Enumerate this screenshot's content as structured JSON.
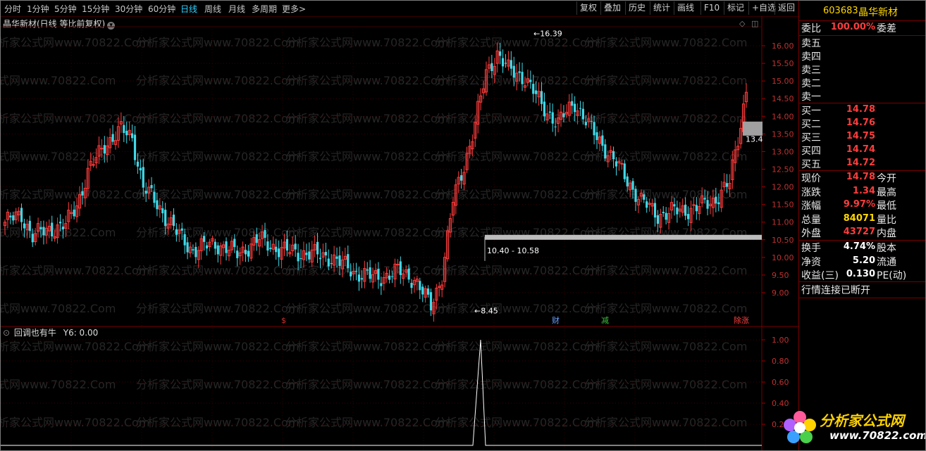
{
  "toolbar": {
    "periods": [
      "分时",
      "1分钟",
      "5分钟",
      "15分钟",
      "30分钟",
      "60分钟",
      "日线",
      "周线",
      "月线",
      "多周期",
      "更多>"
    ],
    "active_period": "日线",
    "buttons": [
      "复权",
      "叠加",
      "历史",
      "统计",
      "画线",
      "F10",
      "标记",
      "+自选",
      "返回"
    ]
  },
  "chart": {
    "title": "晶华新材(日线 等比前复权)",
    "y_ticks": [
      "16.00",
      "15.50",
      "15.00",
      "14.50",
      "14.00",
      "13.50",
      "13.00",
      "12.50",
      "12.00",
      "11.50",
      "11.00",
      "10.50",
      "10.00",
      "9.50",
      "9.00"
    ],
    "high_label": "16.39",
    "low_label": "8.45",
    "range_label": "10.40 - 10.58",
    "cursor_price": "13.4",
    "markers": [
      "$",
      "财",
      "减",
      "除涨"
    ],
    "marker_colors": [
      "#d03030",
      "#6aa0ff",
      "#40c040",
      "#ff4040"
    ],
    "up_color": "#ff3c3c",
    "down_color": "#3fd9e8"
  },
  "indicator": {
    "title": "回调也有牛",
    "value_text": "Y6: 0.00",
    "y_ticks": [
      "1.00",
      "0.80",
      "0.60",
      "0.40",
      "0.20"
    ]
  },
  "panel": {
    "code": "603683",
    "name": "晶华新材",
    "weibi_label": "委比",
    "weibi_value": "100.00%",
    "weicha_label": "委差",
    "sell": [
      {
        "label": "卖五",
        "price": ""
      },
      {
        "label": "卖四",
        "price": ""
      },
      {
        "label": "卖三",
        "price": ""
      },
      {
        "label": "卖二",
        "price": ""
      },
      {
        "label": "卖一",
        "price": ""
      }
    ],
    "buy": [
      {
        "label": "买一",
        "price": "14.78"
      },
      {
        "label": "买二",
        "price": "14.76"
      },
      {
        "label": "买三",
        "price": "14.75"
      },
      {
        "label": "买四",
        "price": "14.74"
      },
      {
        "label": "买五",
        "price": "14.72"
      }
    ],
    "stats": [
      {
        "label": "现价",
        "value": "14.78",
        "label2": "今开",
        "color": "red"
      },
      {
        "label": "涨跌",
        "value": "1.34",
        "label2": "最高",
        "color": "red"
      },
      {
        "label": "涨幅",
        "value": "9.97%",
        "label2": "最低",
        "color": "red"
      },
      {
        "label": "总量",
        "value": "84071",
        "label2": "量比",
        "color": "yellow"
      },
      {
        "label": "外盘",
        "value": "43727",
        "label2": "内盘",
        "color": "red"
      }
    ],
    "stats2": [
      {
        "label": "换手",
        "value": "4.74%",
        "label2": "股本",
        "color": "white"
      },
      {
        "label": "净资",
        "value": "5.20",
        "label2": "流通",
        "color": "white"
      },
      {
        "label": "收益(三)",
        "value": "0.130",
        "label2": "PE(动)",
        "color": "white"
      }
    ],
    "status": "行情连接已断开"
  },
  "logo": {
    "text": "分析家公式网",
    "url": "www.70822.com"
  },
  "watermark": {
    "text1": "分析家公式网www.70822.Com",
    "text2": "公式网www.70822.Com"
  }
}
